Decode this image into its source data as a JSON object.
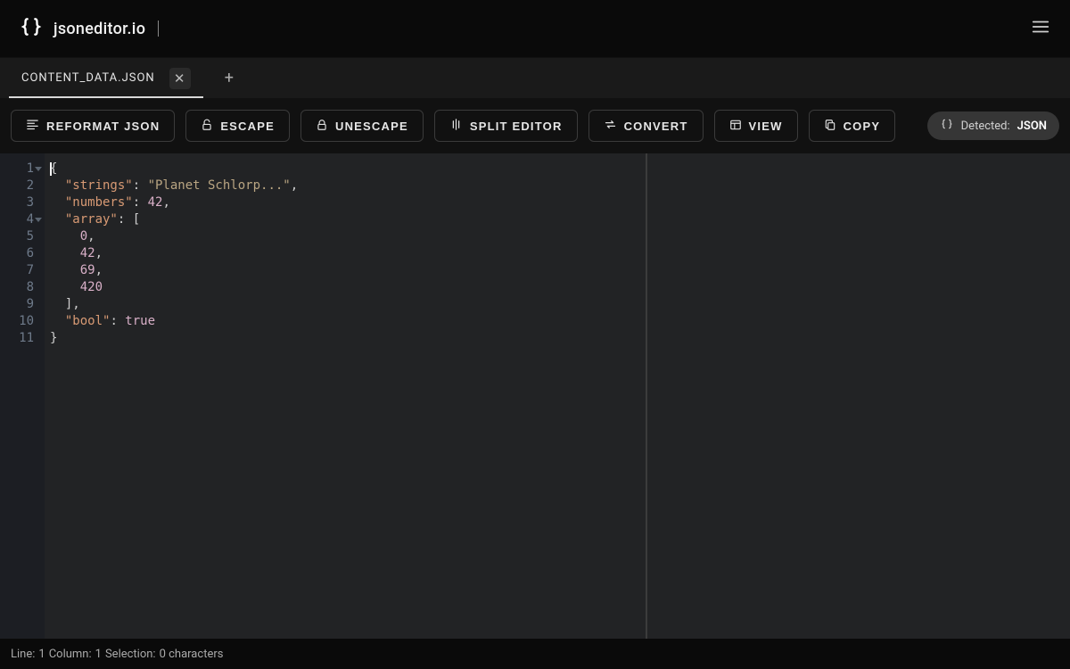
{
  "header": {
    "brand": "jsoneditor.io"
  },
  "tabs": {
    "active": "CONTENT_DATA.JSON"
  },
  "toolbar": {
    "reformat": "REFORMAT JSON",
    "escape": "ESCAPE",
    "unescape": "UNESCAPE",
    "split": "SPLIT EDITOR",
    "convert": "CONVERT",
    "view": "VIEW",
    "copy": "COPY",
    "detected_label": "Detected:",
    "detected_value": "JSON"
  },
  "editor": {
    "line_numbers": [
      "1",
      "2",
      "3",
      "4",
      "5",
      "6",
      "7",
      "8",
      "9",
      "10",
      "11"
    ],
    "json_content": {
      "strings": "Planet Schlorp...",
      "numbers": 42,
      "array": [
        0,
        42,
        69,
        420
      ],
      "bool": true
    },
    "tokens": {
      "l1": "{",
      "l2_key": "\"strings\"",
      "l2_val": "\"Planet Schlorp...\"",
      "l3_key": "\"numbers\"",
      "l3_val": "42",
      "l4_key": "\"array\"",
      "l5": "0",
      "l6": "42",
      "l7": "69",
      "l8": "420",
      "l10_key": "\"bool\"",
      "l10_val": "true",
      "l11": "}"
    }
  },
  "status": {
    "line_label": "Line:",
    "line": "1",
    "col_label": "Column:",
    "col": "1",
    "sel_label": "Selection:",
    "sel": "0 characters"
  }
}
